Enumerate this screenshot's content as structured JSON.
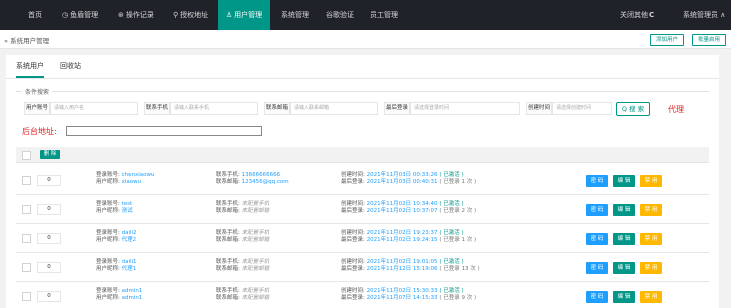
{
  "nav": {
    "items": [
      {
        "label": "首页",
        "icon": "home-icon",
        "glyph": ""
      },
      {
        "label": "鱼盾管理",
        "icon": "clock-icon",
        "glyph": "◷"
      },
      {
        "label": "操作记录",
        "icon": "record-icon",
        "glyph": "⊛"
      },
      {
        "label": "授权地址",
        "icon": "location-icon",
        "glyph": "⚲"
      },
      {
        "label": "用户管理",
        "icon": "user-icon",
        "glyph": "♙",
        "active": true
      },
      {
        "label": "系统管理",
        "icon": "",
        "glyph": ""
      },
      {
        "label": "谷歌验证",
        "icon": "",
        "glyph": ""
      },
      {
        "label": "员工管理",
        "icon": "",
        "glyph": ""
      }
    ],
    "close_others": "关闭其他",
    "refresh_glyph": "C",
    "admin": "系统管理员 ∧",
    "bg_color": "#20222a",
    "active_color": "#009688"
  },
  "crumb": {
    "arrow": "»",
    "text": "系统用户管理",
    "add_user": "添加用户",
    "bulk_enable": "批量启用"
  },
  "tabs": [
    "系统用户",
    "回收站"
  ],
  "search": {
    "legend": "条件搜索",
    "fields": [
      {
        "label": "用户账号",
        "placeholder": "请输入用户名"
      },
      {
        "label": "联系手机",
        "placeholder": "请输入联系手机"
      },
      {
        "label": "联系邮箱",
        "placeholder": "请输入联系邮箱"
      },
      {
        "label": "最后登录",
        "placeholder": "请选择登录时间"
      },
      {
        "label": "创建时间",
        "placeholder": "请选择创建时间"
      }
    ],
    "button": "Q 搜 索",
    "agent": "代理",
    "backend_label": "后台地址:",
    "backend_value": ""
  },
  "table": {
    "delete_label": "删 除",
    "rows": [
      {
        "sort": "0",
        "account": "chenxiaowu",
        "name": "xiaowu",
        "phone": "13666666666",
        "email": "123456@qq.com",
        "created": "2021年11月03日 00:33:26",
        "created_status": "已激活",
        "last_login": "2021年11月03日 00:40:31",
        "login_count": "已登录 1 次",
        "phone_missing": false,
        "email_missing": false
      },
      {
        "sort": "0",
        "account": "test",
        "name": "测试",
        "phone": "未配置手机",
        "email": "未配置邮箱",
        "created": "2021年11月02日 10:34:40",
        "created_status": "已激活",
        "last_login": "2021年11月02日 10:37:07",
        "login_count": "已登录 2 次",
        "phone_missing": true,
        "email_missing": true
      },
      {
        "sort": "0",
        "account": "daili2",
        "name": "代理2",
        "phone": "未配置手机",
        "email": "未配置邮箱",
        "created": "2021年11月02日 19:23:37",
        "created_status": "已激活",
        "last_login": "2021年11月02日 19:24:15",
        "login_count": "已登录 1 次",
        "phone_missing": true,
        "email_missing": true
      },
      {
        "sort": "0",
        "account": "daili1",
        "name": "代理1",
        "phone": "未配置手机",
        "email": "未配置邮箱",
        "created": "2021年11月02日 19:01:05",
        "created_status": "已激活",
        "last_login": "2021年11月12日 15:19:06",
        "login_count": "已登录 13 次",
        "phone_missing": true,
        "email_missing": true
      },
      {
        "sort": "0",
        "account": "admin1",
        "name": "admin1",
        "phone": "未配置手机",
        "email": "未配置邮箱",
        "created": "2021年11月02日 15:30:33",
        "created_status": "已激活",
        "last_login": "2021年11月07日 14:15:33",
        "login_count": "已登录 9 次",
        "phone_missing": true,
        "email_missing": true
      }
    ],
    "labels": {
      "account": "登录账号: ",
      "name": "用户昵称: ",
      "phone": "联系手机: ",
      "email": "联系邮箱: ",
      "created": "创建时间: ",
      "last_login": "最后登录: "
    },
    "actions": {
      "password": "密 码",
      "edit": "编 辑",
      "disable": "禁 用"
    },
    "action_colors": {
      "password": "#1E9FFF",
      "edit": "#009688",
      "disable": "#FFB800"
    }
  }
}
